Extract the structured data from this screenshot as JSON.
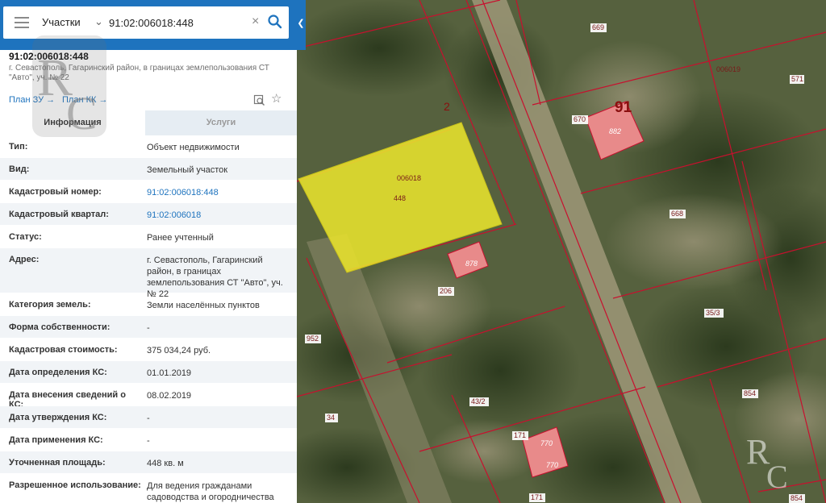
{
  "search": {
    "layer": "Участки",
    "query": "91:02:006018:448"
  },
  "object": {
    "title": "91:02:006018:448",
    "address_short": "г. Севастополь, Гагаринский район, в границах землепользования СТ \"Авто\", уч. № 22"
  },
  "links": {
    "plan_zu": "План ЗУ →",
    "plan_kk": "План КК →"
  },
  "tabs": {
    "info": "Информация",
    "services": "Услуги"
  },
  "properties": [
    {
      "key": "Тип:",
      "value": "Объект недвижимости"
    },
    {
      "key": "Вид:",
      "value": "Земельный участок"
    },
    {
      "key": "Кадастровый номер:",
      "value": "91:02:006018:448"
    },
    {
      "key": "Кадастровый квартал:",
      "value": "91:02:006018"
    },
    {
      "key": "Статус:",
      "value": "Ранее учтенный"
    },
    {
      "key": "Адрес:",
      "value": "г. Севастополь, Гагаринский район, в границах землепользования СТ \"Авто\", уч. № 22"
    },
    {
      "key": "Категория земель:",
      "value": "Земли населённых пунктов"
    },
    {
      "key": "Форма собственности:",
      "value": "-"
    },
    {
      "key": "Кадастровая стоимость:",
      "value": "375 034,24 руб."
    },
    {
      "key": "Дата определения КС:",
      "value": "01.01.2019"
    },
    {
      "key": "Дата внесения сведений о КС:",
      "value": "08.02.2019"
    },
    {
      "key": "Дата утверждения КС:",
      "value": "-"
    },
    {
      "key": "Дата применения КС:",
      "value": "-"
    },
    {
      "key": "Уточненная площадь:",
      "value": "448 кв. м"
    },
    {
      "key": "Разрешенное использование:",
      "value": "Для ведения гражданами садоводства и огородничества"
    }
  ],
  "map_labels": {
    "block_selected": "006018",
    "parcel_selected": "448",
    "block_other": "006019",
    "quarter_big": "91",
    "line_label": "2",
    "p669": "669",
    "p571": "571",
    "p670": "670",
    "p882": "882",
    "p668": "668",
    "p878": "878",
    "p206": "206",
    "p35_3": "35/3",
    "p952": "952",
    "p43_2": "43/2",
    "p34": "34",
    "p854a": "854",
    "p854b": "854",
    "p171a": "171",
    "p171b": "171",
    "p770a": "770",
    "p770b": "770"
  },
  "icons": {
    "menu": "menu-icon",
    "chevron": "chevron-down-icon",
    "clear": "close-icon",
    "search": "search-icon",
    "collapse": "chevron-left-icon",
    "map_object": "map-search-icon",
    "favorite": "star-icon"
  },
  "colors": {
    "brand": "#1e73be",
    "selected_parcel": "#e8e22e",
    "parcel_border": "#c8102e",
    "building_fill": "#e88a8a"
  }
}
